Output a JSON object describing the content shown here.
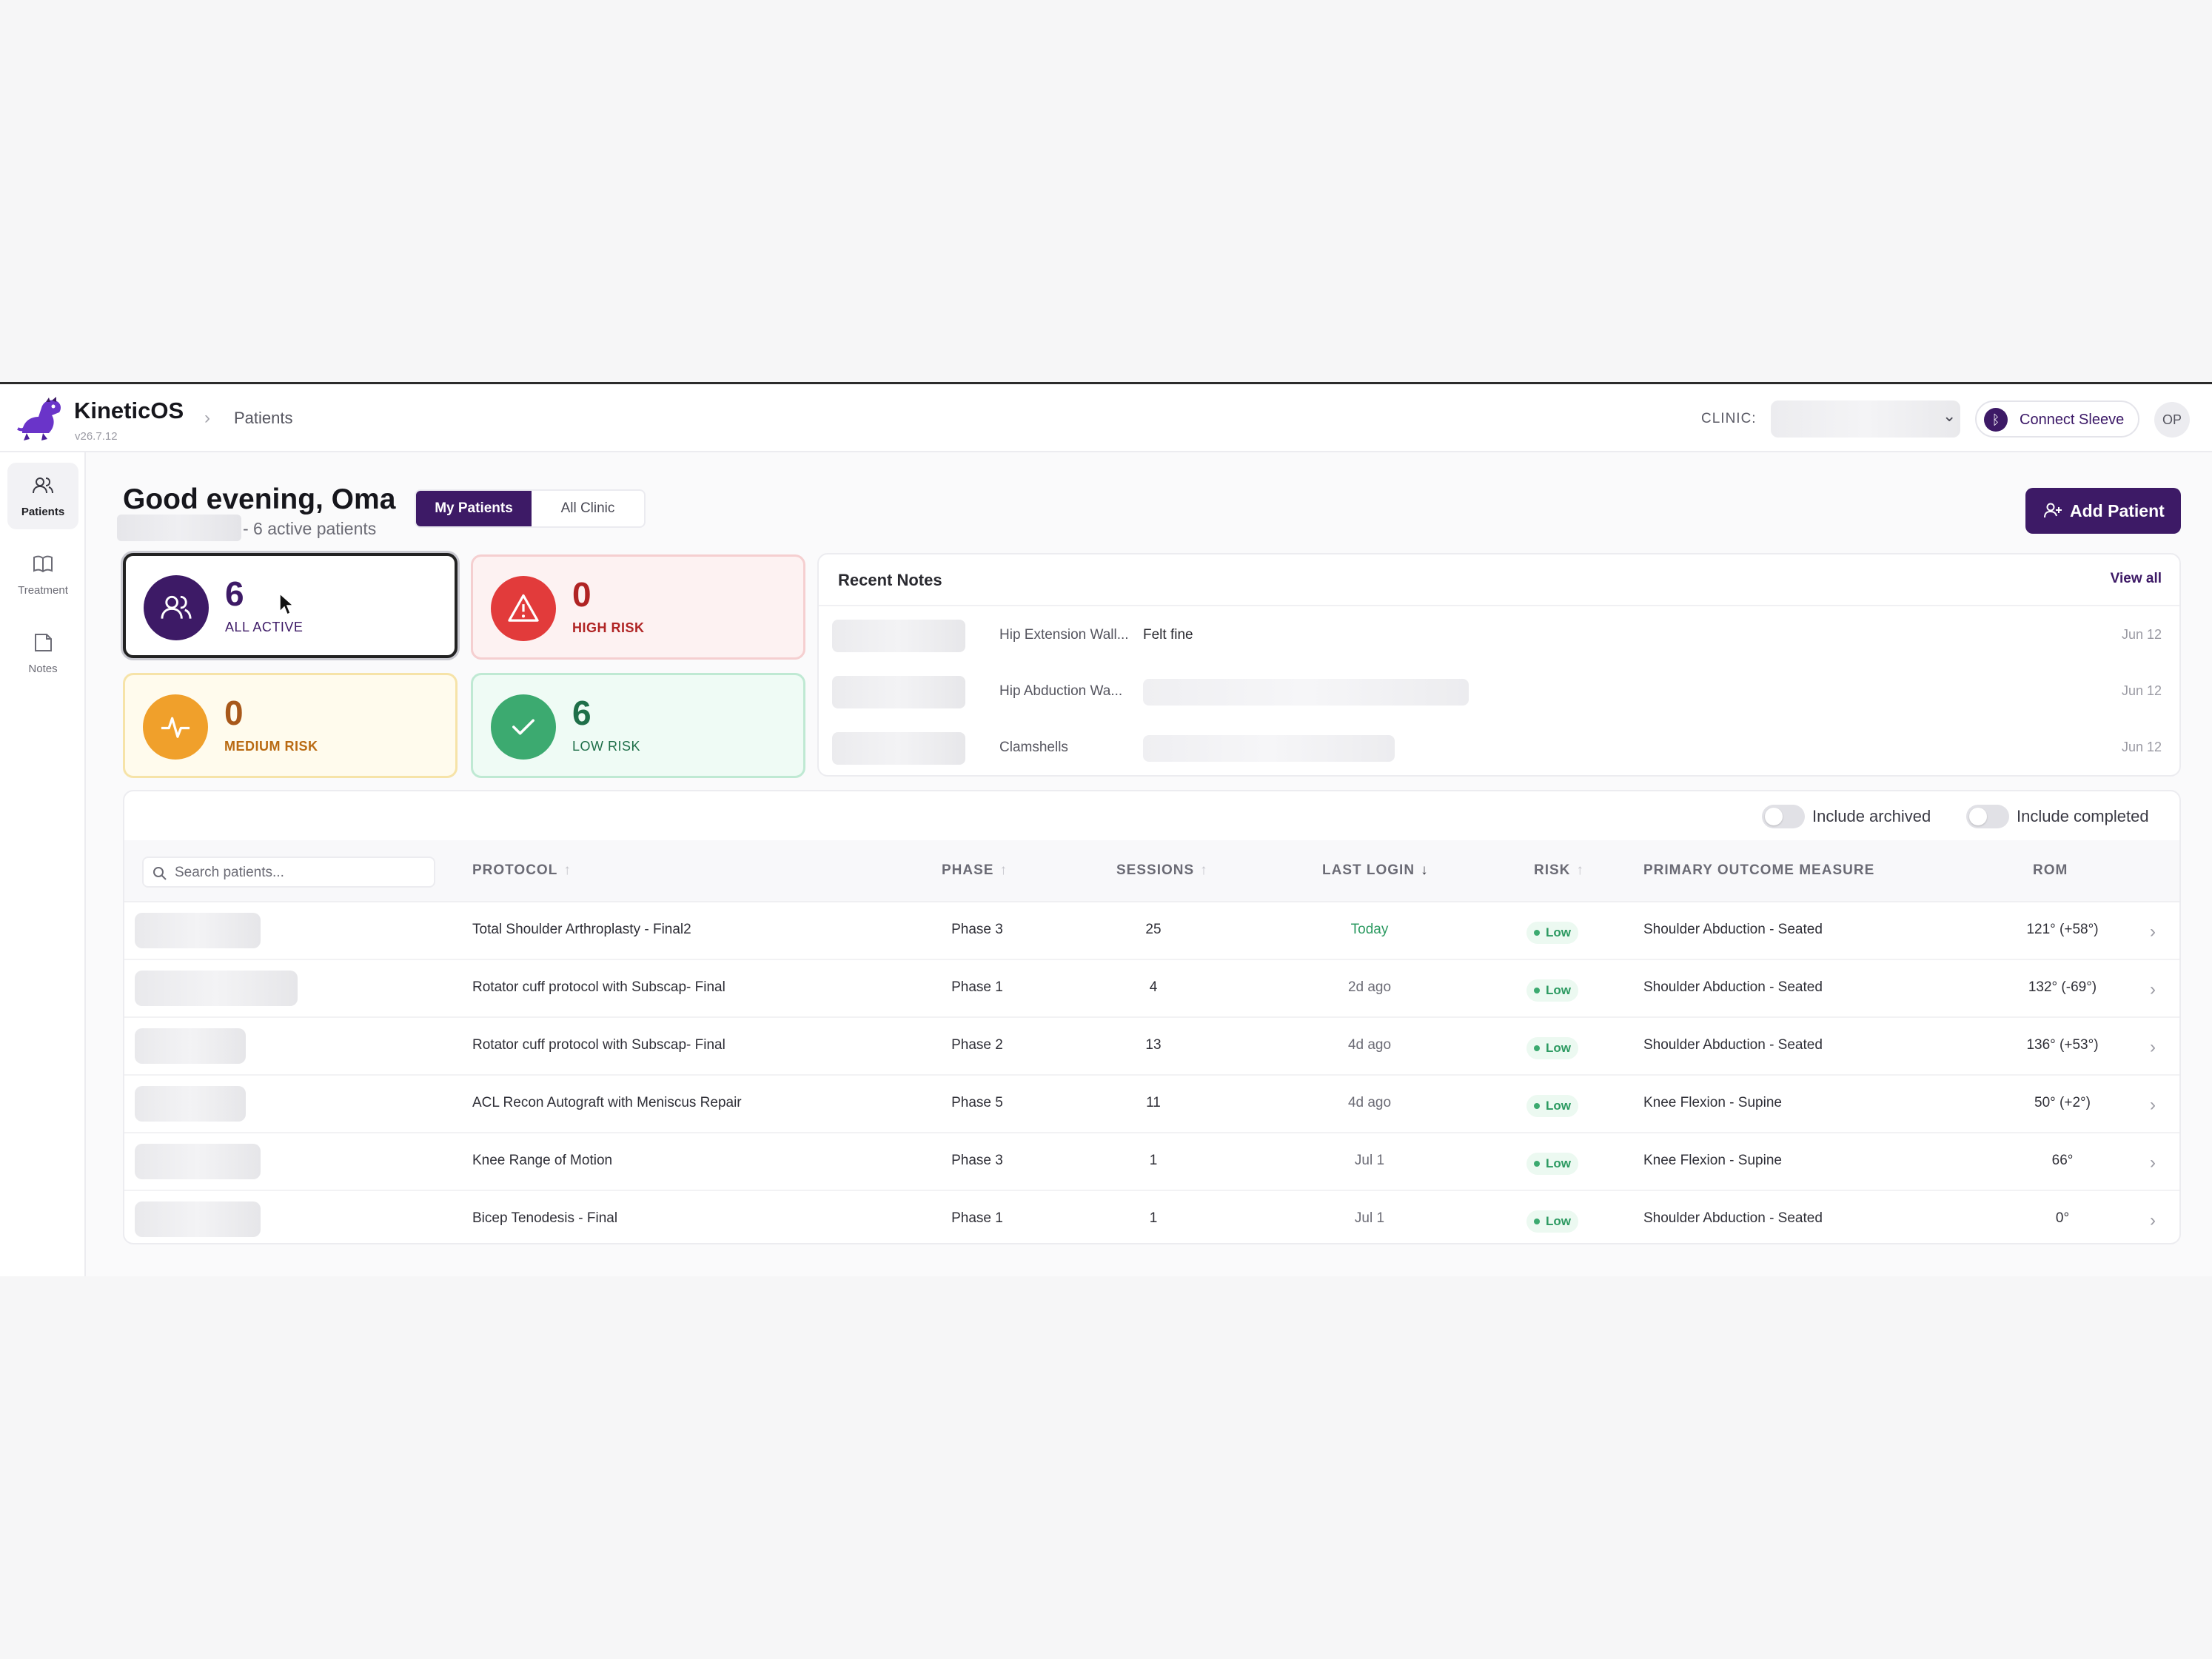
{
  "app": {
    "name": "KineticOS",
    "version": "v26.7.12"
  },
  "breadcrumb": {
    "current": "Patients"
  },
  "topbar": {
    "clinic_label": "CLINIC:",
    "connect_label": "Connect Sleeve",
    "avatar_initials": "OP"
  },
  "sidebar": {
    "items": [
      {
        "label": "Patients",
        "icon": "users-icon",
        "active": true
      },
      {
        "label": "Treatment",
        "icon": "book-icon",
        "active": false
      },
      {
        "label": "Notes",
        "icon": "note-icon",
        "active": false
      }
    ]
  },
  "header": {
    "greeting": "Good evening, Oma",
    "subtitle": "- 6 active patients",
    "tabs": [
      {
        "label": "My Patients",
        "selected": true
      },
      {
        "label": "All Clinic",
        "selected": false
      }
    ],
    "add_patient_label": "Add Patient"
  },
  "stats": {
    "all": {
      "value": "6",
      "label": "ALL ACTIVE"
    },
    "high": {
      "value": "0",
      "label": "HIGH RISK"
    },
    "medium": {
      "value": "0",
      "label": "MEDIUM RISK"
    },
    "low": {
      "value": "6",
      "label": "LOW RISK"
    }
  },
  "recent_notes": {
    "title": "Recent Notes",
    "view_all": "View all",
    "items": [
      {
        "exercise": "Hip Extension Wall...",
        "text": "Felt fine",
        "date": "Jun 12"
      },
      {
        "exercise": "Hip Abduction Wa...",
        "text": "",
        "date": "Jun 12"
      },
      {
        "exercise": "Clamshells",
        "text": "",
        "date": "Jun 12"
      }
    ]
  },
  "filters": {
    "include_archived": "Include archived",
    "include_completed": "Include completed"
  },
  "table": {
    "search_placeholder": "Search patients...",
    "columns": {
      "protocol": "PROTOCOL",
      "phase": "PHASE",
      "sessions": "SESSIONS",
      "last_login": "LAST LOGIN",
      "risk": "RISK",
      "outcome": "PRIMARY OUTCOME MEASURE",
      "rom": "ROM"
    },
    "rows": [
      {
        "protocol": "Total Shoulder Arthroplasty - Final2",
        "phase": "Phase 3",
        "sessions": "25",
        "last_login": "Today",
        "risk": "Low",
        "outcome": "Shoulder Abduction - Seated",
        "rom": "121° (+58°)"
      },
      {
        "protocol": "Rotator cuff protocol with Subscap- Final",
        "phase": "Phase 1",
        "sessions": "4",
        "last_login": "2d ago",
        "risk": "Low",
        "outcome": "Shoulder Abduction - Seated",
        "rom": "132° (-69°)"
      },
      {
        "protocol": "Rotator cuff protocol with Subscap- Final",
        "phase": "Phase 2",
        "sessions": "13",
        "last_login": "4d ago",
        "risk": "Low",
        "outcome": "Shoulder Abduction - Seated",
        "rom": "136° (+53°)"
      },
      {
        "protocol": "ACL Recon Autograft with Meniscus Repair",
        "phase": "Phase 5",
        "sessions": "11",
        "last_login": "4d ago",
        "risk": "Low",
        "outcome": "Knee Flexion - Supine",
        "rom": "50° (+2°)"
      },
      {
        "protocol": "Knee Range of Motion",
        "phase": "Phase 3",
        "sessions": "1",
        "last_login": "Jul 1",
        "risk": "Low",
        "outcome": "Knee Flexion - Supine",
        "rom": "66°"
      },
      {
        "protocol": "Bicep Tenodesis - Final",
        "phase": "Phase 1",
        "sessions": "1",
        "last_login": "Jul 1",
        "risk": "Low",
        "outcome": "Shoulder Abduction - Seated",
        "rom": "0°"
      }
    ]
  },
  "colors": {
    "brand": "#3d1a66",
    "high": "#e23b3b",
    "medium": "#f0a02b",
    "low": "#3caa70"
  }
}
